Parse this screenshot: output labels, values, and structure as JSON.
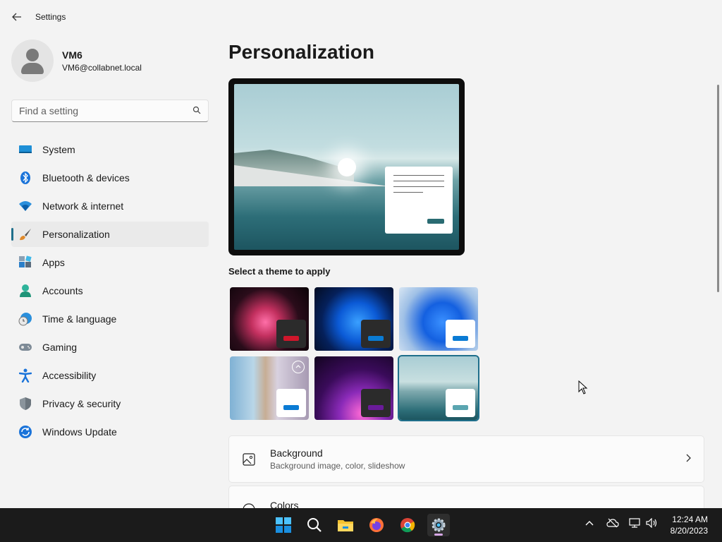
{
  "app": {
    "title": "Settings"
  },
  "user": {
    "name": "VM6",
    "email": "VM6@collabnet.local"
  },
  "search": {
    "placeholder": "Find a setting"
  },
  "sidebar": {
    "items": [
      {
        "label": "System",
        "icon": "monitor-icon"
      },
      {
        "label": "Bluetooth & devices",
        "icon": "bluetooth-icon"
      },
      {
        "label": "Network & internet",
        "icon": "wifi-icon"
      },
      {
        "label": "Personalization",
        "icon": "paintbrush-icon",
        "active": true
      },
      {
        "label": "Apps",
        "icon": "apps-icon"
      },
      {
        "label": "Accounts",
        "icon": "person-icon"
      },
      {
        "label": "Time & language",
        "icon": "globe-clock-icon"
      },
      {
        "label": "Gaming",
        "icon": "gamepad-icon"
      },
      {
        "label": "Accessibility",
        "icon": "accessibility-icon"
      },
      {
        "label": "Privacy & security",
        "icon": "shield-icon"
      },
      {
        "label": "Windows Update",
        "icon": "update-icon"
      }
    ]
  },
  "main": {
    "title": "Personalization",
    "themes_label": "Select a theme to apply",
    "themes": [
      {
        "name": "theme-glow",
        "accent": "#d0162b"
      },
      {
        "name": "theme-dark-bloom",
        "accent": "#0a7bd4"
      },
      {
        "name": "theme-light-bloom",
        "accent": "#0a7bd4"
      },
      {
        "name": "theme-spotlight",
        "accent": "#0a7bd4"
      },
      {
        "name": "theme-flow",
        "accent": "#6a1b9a"
      },
      {
        "name": "theme-sunrise",
        "accent": "#5aa5b0",
        "selected": true
      }
    ],
    "cards": [
      {
        "title": "Background",
        "subtitle": "Background image, color, slideshow"
      },
      {
        "title": "Colors",
        "subtitle": ""
      }
    ]
  },
  "taskbar": {
    "apps": [
      "start-icon",
      "search-icon",
      "file-explorer-icon",
      "firefox-icon",
      "chrome-icon",
      "settings-icon"
    ],
    "clock": {
      "time": "12:24 AM",
      "date": "8/20/2023"
    }
  },
  "colors": {
    "accent": "#1f6f8b",
    "taskbar": "#1b1b1b",
    "background": "#f3f3f3"
  }
}
